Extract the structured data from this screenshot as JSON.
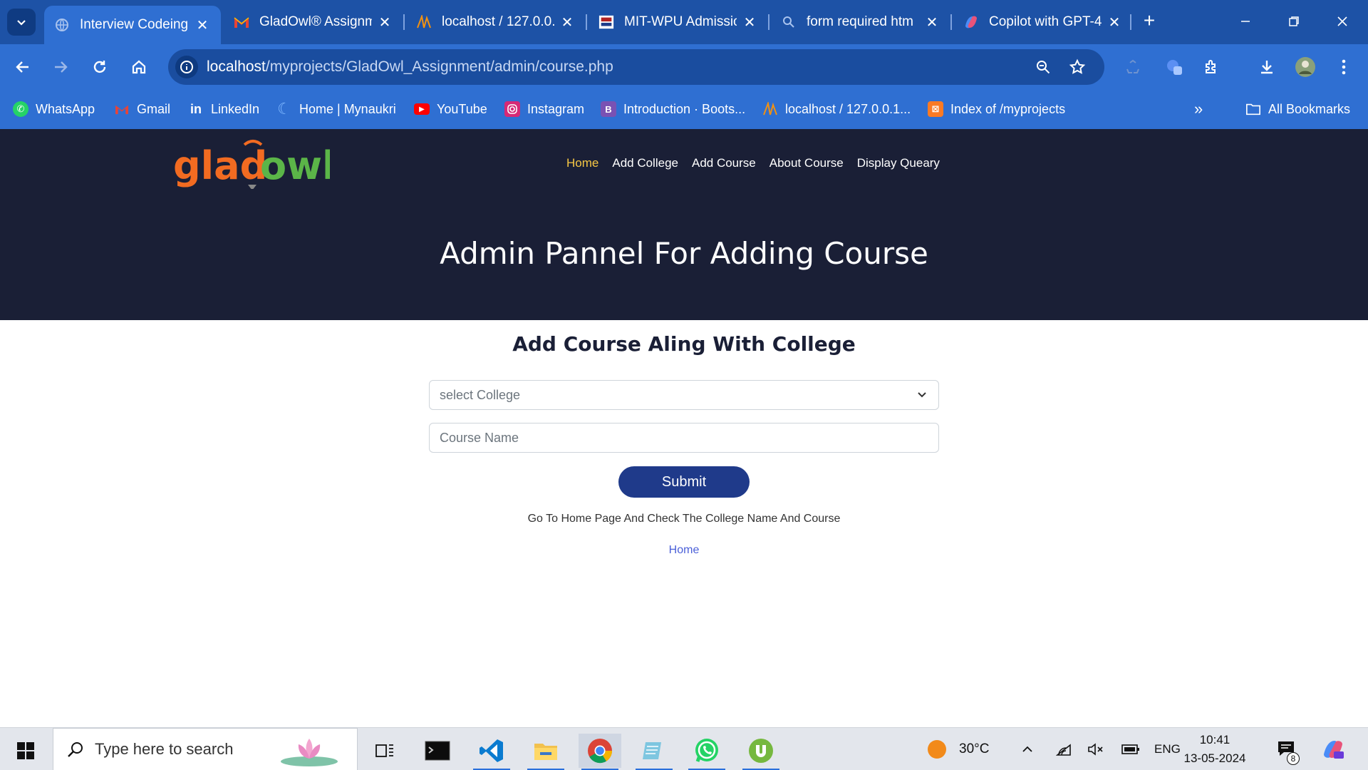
{
  "browser": {
    "tabs": [
      {
        "title": "Interview Codeing",
        "active": true,
        "icon": "globe-icon"
      },
      {
        "title": "GladOwl® Assignm",
        "active": false,
        "icon": "gmail-icon"
      },
      {
        "title": "localhost / 127.0.0.",
        "active": false,
        "icon": "phpmyadmin-icon"
      },
      {
        "title": "MIT-WPU Admissio",
        "active": false,
        "icon": "mitwpu-icon"
      },
      {
        "title": "form required htm",
        "active": false,
        "icon": "search-icon"
      },
      {
        "title": "Copilot with GPT-4",
        "active": false,
        "icon": "copilot-icon"
      }
    ],
    "url_host": "localhost",
    "url_path": "/myprojects/GladOwl_Assignment/admin/course.php",
    "bookmarks": [
      {
        "label": "WhatsApp",
        "icon": "whatsapp-icon",
        "color": "#25d366"
      },
      {
        "label": "Gmail",
        "icon": "gmail-icon",
        "color": "#ea4335"
      },
      {
        "label": "LinkedIn",
        "icon": "linkedin-icon",
        "color": "#0a66c2"
      },
      {
        "label": "Home | Mynaukri",
        "icon": "mynaukri-icon",
        "color": "#4aa3ff"
      },
      {
        "label": "YouTube",
        "icon": "youtube-icon",
        "color": "#ff0000"
      },
      {
        "label": "Instagram",
        "icon": "instagram-icon",
        "color": "#d62976"
      },
      {
        "label": "Introduction · Boots...",
        "icon": "bootstrap-icon",
        "color": "#7952b3"
      },
      {
        "label": "localhost / 127.0.0.1...",
        "icon": "phpmyadmin-icon",
        "color": "#f29111"
      },
      {
        "label": "Index of /myprojects",
        "icon": "xampp-icon",
        "color": "#fb7a24"
      }
    ],
    "all_bookmarks": "All Bookmarks"
  },
  "site": {
    "logo_text": "gladowl",
    "nav": [
      {
        "label": "Home",
        "active": true
      },
      {
        "label": "Add College",
        "active": false
      },
      {
        "label": "Add Course",
        "active": false
      },
      {
        "label": "About Course",
        "active": false
      },
      {
        "label": "Display Queary",
        "active": false
      }
    ],
    "hero_title": "Admin Pannel For Adding Course",
    "form_title": "Add Course Aling With College",
    "college_select_value": "select College",
    "course_placeholder": "Course Name",
    "submit_label": "Submit",
    "info_text": "Go To Home Page And Check The College Name And Course",
    "home_link": "Home"
  },
  "taskbar": {
    "search_placeholder": "Type here to search",
    "weather": "30°C",
    "language": "ENG",
    "time": "10:41",
    "date": "13-05-2024",
    "notification_count": "8",
    "apps": [
      "terminal-icon",
      "vscode-icon",
      "file-explorer-icon",
      "chrome-icon",
      "notepad-icon",
      "whatsapp-icon",
      "utorrent-icon"
    ]
  },
  "colors": {
    "chrome_dark": "#1d52a6",
    "chrome_toolbar": "#2f6fd2",
    "hero_bg": "#1a1f36",
    "nav_active": "#f6c744",
    "submit_bg": "#1f3a8a",
    "link": "#4a5fd8",
    "logo_orange": "#f26b21",
    "logo_green": "#5bb548"
  }
}
